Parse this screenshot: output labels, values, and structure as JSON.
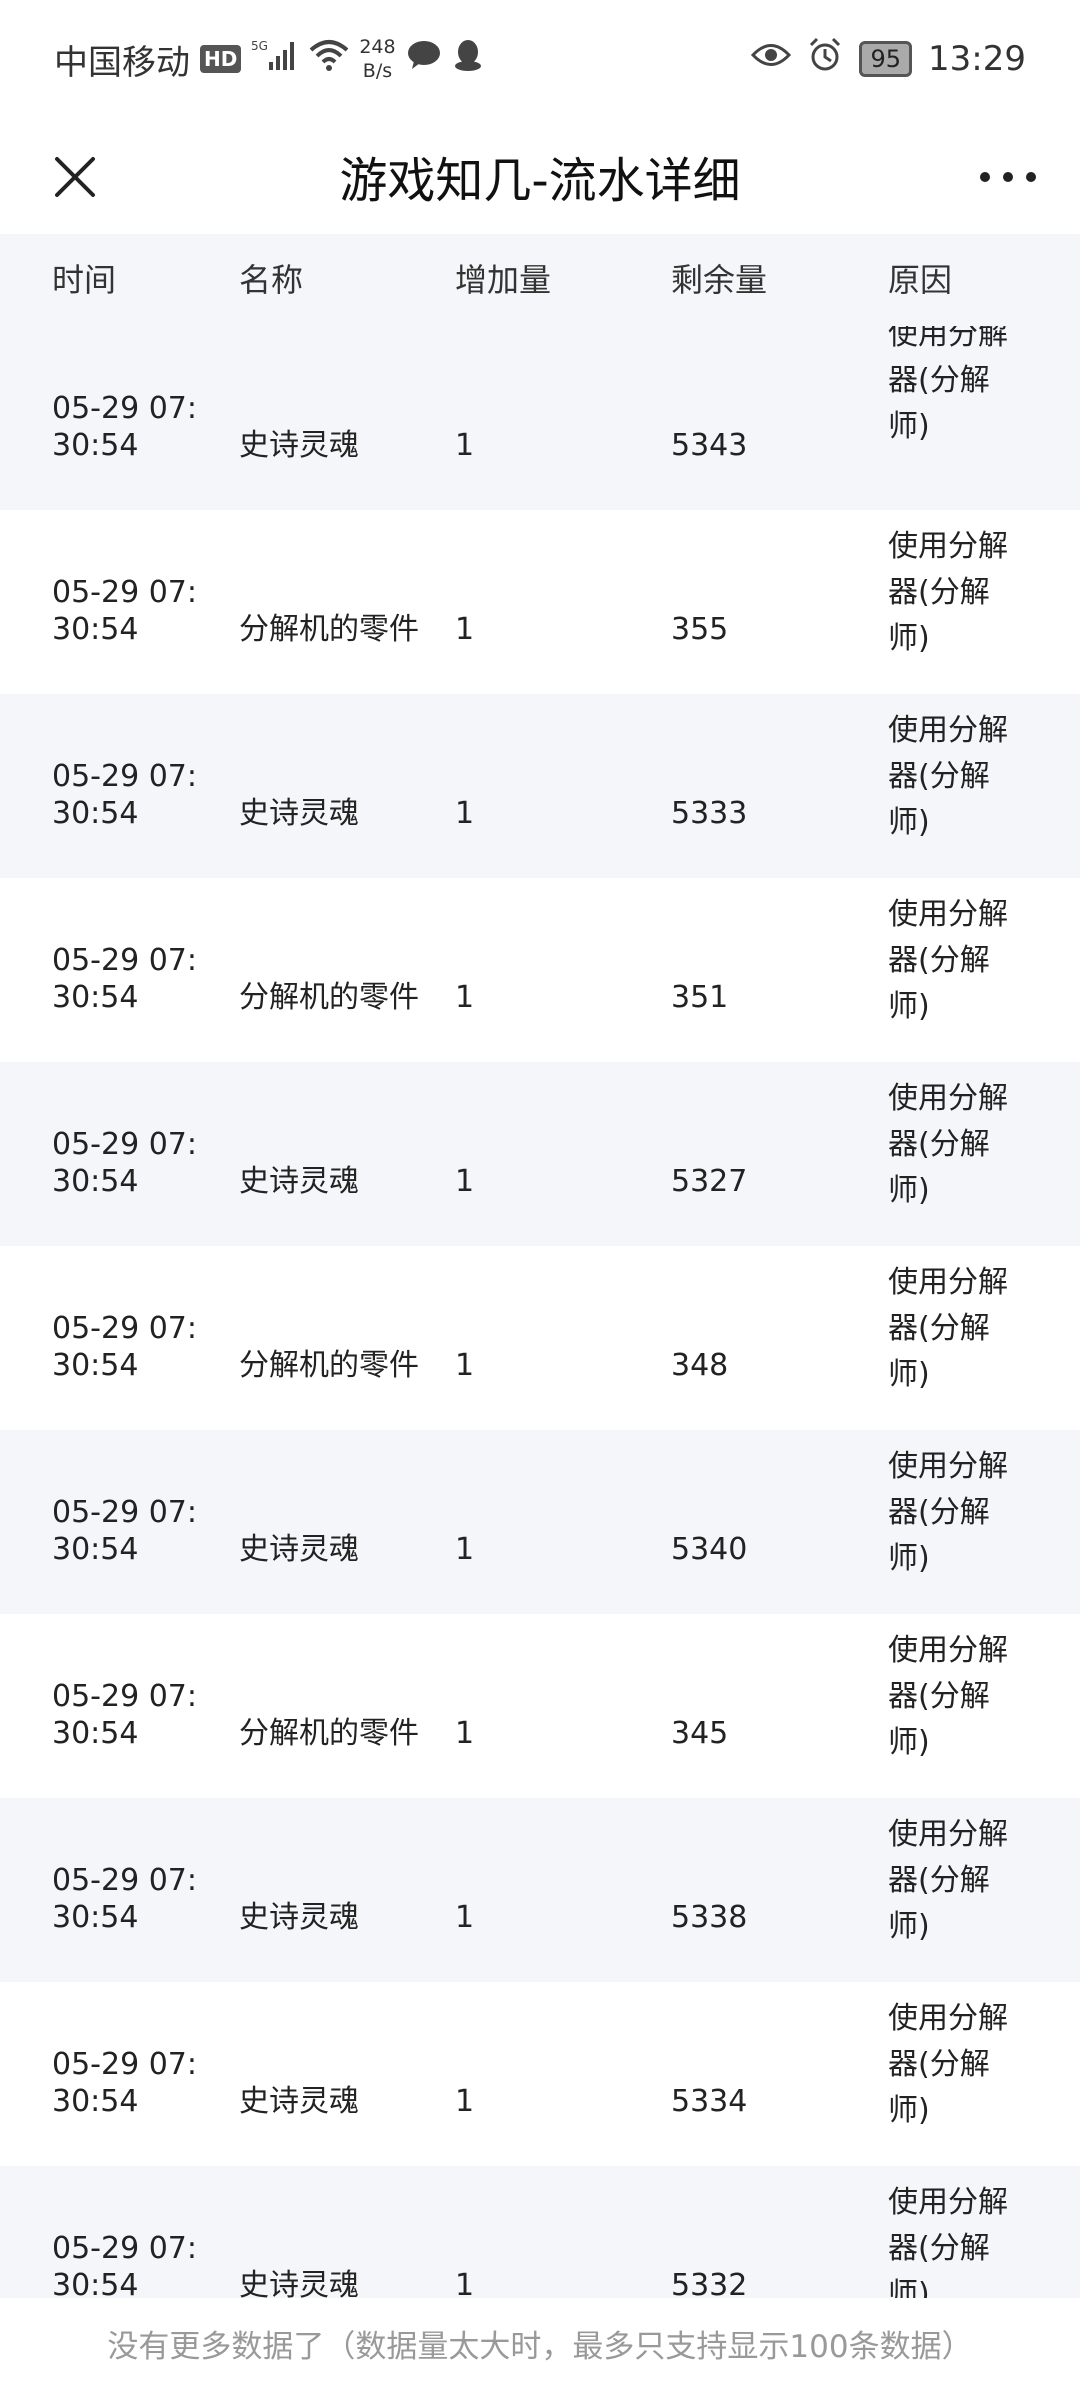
{
  "status_bar": {
    "carrier": "中国移动",
    "hd": "HD",
    "network": "5G",
    "speed_value": "248",
    "speed_unit": "B/s",
    "battery": "95",
    "time": "13:29"
  },
  "title_bar": {
    "title": "游戏知几-流水详细"
  },
  "table": {
    "headers": {
      "time": "时间",
      "name": "名称",
      "add": "增加量",
      "rest": "剩余量",
      "reason": "原因"
    },
    "rows": [
      {
        "time": "05-29 07:30:54",
        "name": "史诗灵魂",
        "add": "1",
        "rest": "5343",
        "reason": "使用分解器(分解师)"
      },
      {
        "time": "05-29 07:30:54",
        "name": "分解机的零件",
        "add": "1",
        "rest": "355",
        "reason": "使用分解器(分解师)"
      },
      {
        "time": "05-29 07:30:54",
        "name": "史诗灵魂",
        "add": "1",
        "rest": "5333",
        "reason": "使用分解器(分解师)"
      },
      {
        "time": "05-29 07:30:54",
        "name": "分解机的零件",
        "add": "1",
        "rest": "351",
        "reason": "使用分解器(分解师)"
      },
      {
        "time": "05-29 07:30:54",
        "name": "史诗灵魂",
        "add": "1",
        "rest": "5327",
        "reason": "使用分解器(分解师)"
      },
      {
        "time": "05-29 07:30:54",
        "name": "分解机的零件",
        "add": "1",
        "rest": "348",
        "reason": "使用分解器(分解师)"
      },
      {
        "time": "05-29 07:30:54",
        "name": "史诗灵魂",
        "add": "1",
        "rest": "5340",
        "reason": "使用分解器(分解师)"
      },
      {
        "time": "05-29 07:30:54",
        "name": "分解机的零件",
        "add": "1",
        "rest": "345",
        "reason": "使用分解器(分解师)"
      },
      {
        "time": "05-29 07:30:54",
        "name": "史诗灵魂",
        "add": "1",
        "rest": "5338",
        "reason": "使用分解器(分解师)"
      },
      {
        "time": "05-29 07:30:54",
        "name": "史诗灵魂",
        "add": "1",
        "rest": "5334",
        "reason": "使用分解器(分解师)"
      },
      {
        "time": "05-29 07:30:54",
        "name": "史诗灵魂",
        "add": "1",
        "rest": "5332",
        "reason": "使用分解器(分解师)"
      }
    ]
  },
  "footer": {
    "text": "没有更多数据了（数据量太大时，最多只支持显示100条数据）"
  }
}
